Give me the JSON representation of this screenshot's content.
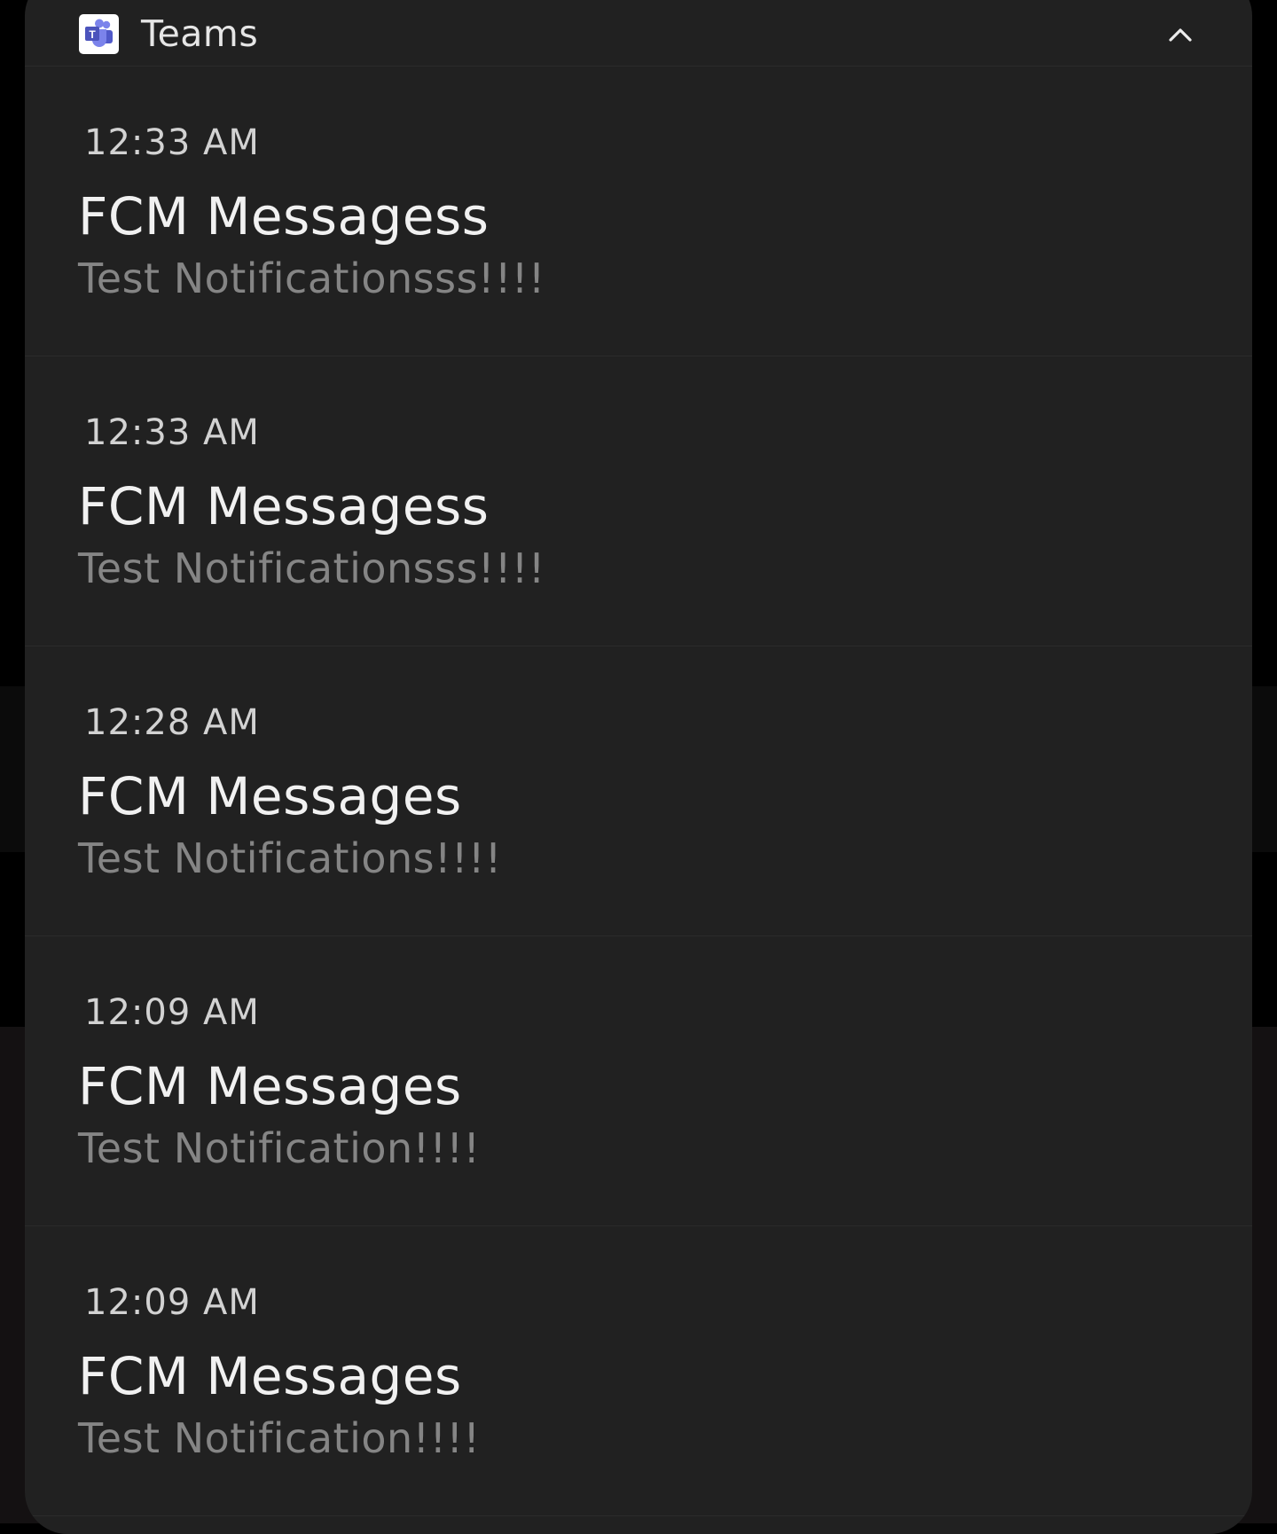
{
  "group": {
    "app_name": "Teams",
    "app_icon": "teams-icon",
    "collapse_icon": "chevron-up-icon"
  },
  "notifications": [
    {
      "time": "12:33 AM",
      "title": "FCM Messagess",
      "body": "Test Notificationsss!!!!"
    },
    {
      "time": "12:33 AM",
      "title": "FCM Messagess",
      "body": "Test Notificationsss!!!!"
    },
    {
      "time": "12:28 AM",
      "title": "FCM Messages",
      "body": "Test Notifications!!!!"
    },
    {
      "time": "12:09 AM",
      "title": "FCM Messages",
      "body": "Test Notification!!!!"
    },
    {
      "time": "12:09 AM",
      "title": "FCM Messages",
      "body": "Test Notification!!!!"
    }
  ],
  "colors": {
    "panel_background": "#212121",
    "teams_brand": "#5059C9",
    "title_text": "#f1f1f1",
    "body_text": "#858585"
  }
}
